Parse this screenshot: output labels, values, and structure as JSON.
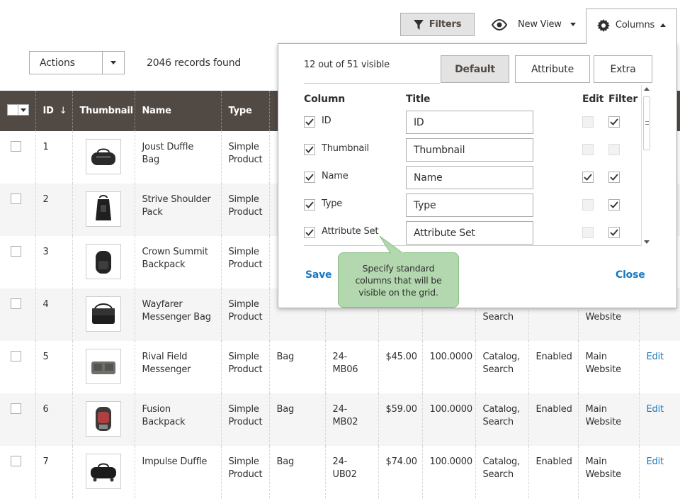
{
  "toolbar": {
    "filters_label": "Filters",
    "view_label": "New View",
    "columns_label": "Columns"
  },
  "actions": {
    "label": "Actions",
    "records": "2046 records found"
  },
  "grid": {
    "headers": {
      "id": "ID",
      "thumbnail": "Thumbnail",
      "name": "Name",
      "type": "Type"
    },
    "rows": [
      {
        "id": "1",
        "name": "Joust Duffle Bag",
        "type": "Simple Product"
      },
      {
        "id": "2",
        "name": "Strive Shoulder Pack",
        "type": "Simple Product"
      },
      {
        "id": "3",
        "name": "Crown Summit Backpack",
        "type": "Simple Product"
      },
      {
        "id": "4",
        "name": "Wayfarer Messenger Bag",
        "type": "Simple Product",
        "websites": "Website"
      },
      {
        "id": "5",
        "name": "Rival Field Messenger",
        "type": "Simple Product",
        "attribute_set": "Bag",
        "sku": "24-MB06",
        "price": "$45.00",
        "quantity": "100.0000",
        "visibility": "Catalog, Search",
        "status": "Enabled",
        "websites": "Main Website",
        "action": "Edit"
      },
      {
        "id": "6",
        "name": "Fusion Backpack",
        "type": "Simple Product",
        "attribute_set": "Bag",
        "sku": "24-MB02",
        "price": "$59.00",
        "quantity": "100.0000",
        "visibility": "Catalog, Search",
        "status": "Enabled",
        "websites": "Main Website",
        "action": "Edit"
      },
      {
        "id": "7",
        "name": "Impulse Duffle",
        "type": "Simple Product",
        "attribute_set": "Bag",
        "sku": "24-UB02",
        "price": "$74.00",
        "quantity": "100.0000",
        "visibility": "Catalog, Search",
        "status": "Enabled",
        "websites": "Main Website",
        "action": "Edit"
      }
    ],
    "row4_visibility_tail": "Search"
  },
  "panel": {
    "visible_count": "12 out of 51 visible",
    "tabs": [
      "Default",
      "Attribute",
      "Extra"
    ],
    "headers": {
      "column": "Column",
      "title": "Title",
      "edit": "Edit",
      "filter": "Filter"
    },
    "columns": [
      {
        "label": "ID",
        "title": "ID",
        "checked": true,
        "edit": false,
        "edit_enabled": false,
        "filter": true
      },
      {
        "label": "Thumbnail",
        "title": "Thumbnail",
        "checked": true,
        "edit": false,
        "edit_enabled": false,
        "filter": false
      },
      {
        "label": "Name",
        "title": "Name",
        "checked": true,
        "edit": true,
        "edit_enabled": true,
        "filter": true
      },
      {
        "label": "Type",
        "title": "Type",
        "checked": true,
        "edit": false,
        "edit_enabled": false,
        "filter": true
      },
      {
        "label": "Attribute Set",
        "title": "Attribute Set",
        "checked": true,
        "edit": false,
        "edit_enabled": false,
        "filter": true
      }
    ],
    "save_label": "Save",
    "close_label": "Close",
    "tooltip": "Specify standard columns that will be visible on the grid."
  },
  "colors": {
    "header_bg": "#514943",
    "link": "#1979c3",
    "tooltip_bg": "#b3d7ae"
  }
}
